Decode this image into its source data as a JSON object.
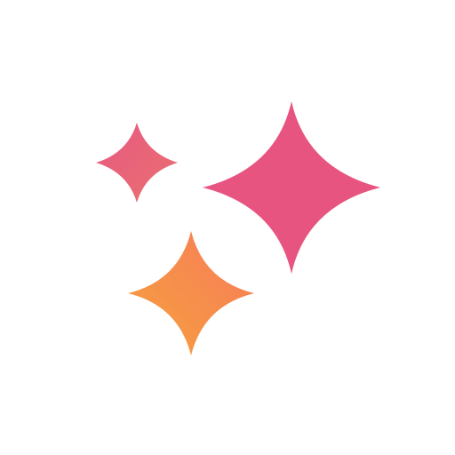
{
  "icon": {
    "name": "sparkles-icon",
    "colors": {
      "background": "#ffffff",
      "large_sparkle": "#e85480",
      "small_sparkle_start": "#e75a82",
      "small_sparkle_end": "#ea6f6f",
      "bottom_sparkle_start": "#f77b5a",
      "bottom_sparkle_end": "#f6a13d"
    }
  }
}
